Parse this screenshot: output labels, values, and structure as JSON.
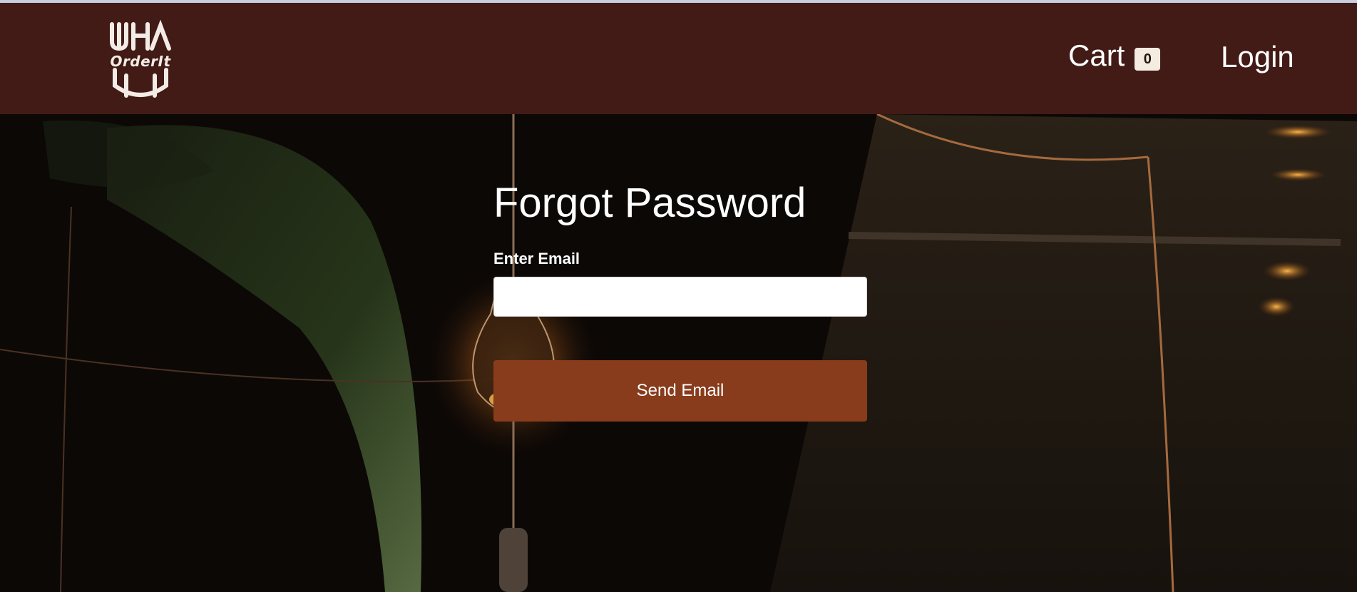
{
  "header": {
    "logo_text": "OrderIt",
    "cart_label": "Cart",
    "cart_count": "0",
    "login_label": "Login"
  },
  "form": {
    "title": "Forgot Password",
    "email_label": "Enter Email",
    "email_value": "",
    "email_placeholder": "",
    "submit_label": "Send Email"
  },
  "colors": {
    "navbar": "#421b16",
    "button": "#883c1c",
    "badge": "#f5ece1"
  },
  "icons": {
    "logo": "orderit-logo-icon"
  }
}
